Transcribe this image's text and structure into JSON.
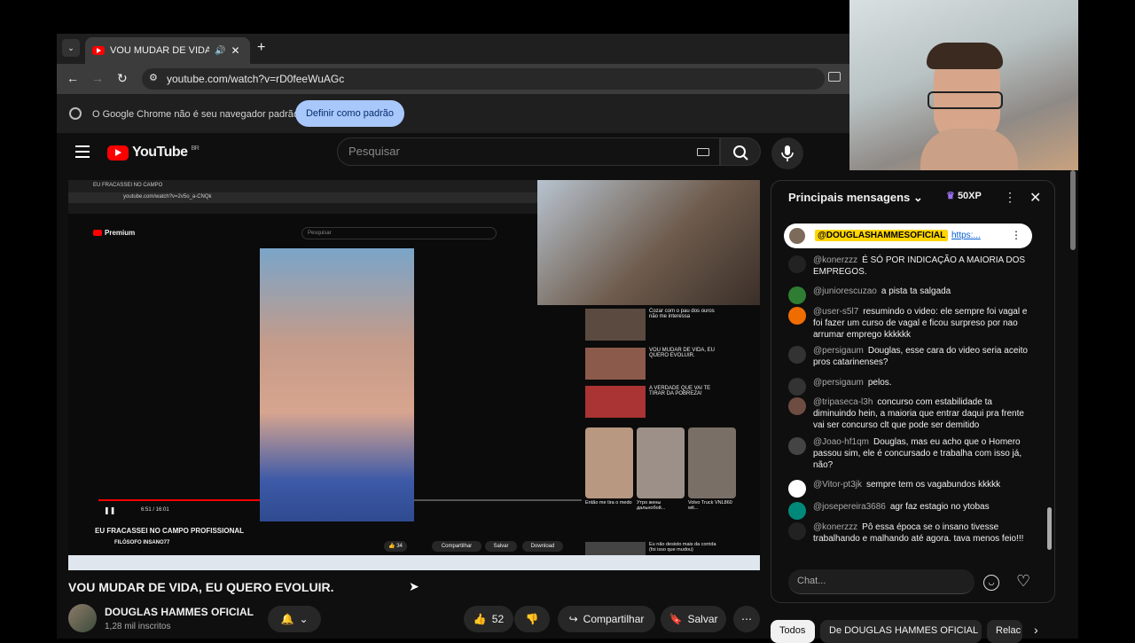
{
  "browser": {
    "tab_title": "VOU MUDAR DE VIDA, EU",
    "url": "youtube.com/watch?v=rD0feeWuAGc",
    "infobar_text": "O Google Chrome não é seu navegador padrão",
    "infobar_button": "Definir como padrão"
  },
  "youtube": {
    "logo_text": "YouTube",
    "region": "BR",
    "search_placeholder": "Pesquisar"
  },
  "video": {
    "title": "VOU MUDAR DE VIDA, EU QUERO EVOLUIR.",
    "channel": "DOUGLAS HAMMES OFICIAL",
    "subscribers": "1,28 mil inscritos",
    "likes": "52",
    "share_label": "Compartilhar",
    "save_label": "Salvar",
    "inner": {
      "title": "EU FRACASSEI NO CAMPO PROFISSIONAL",
      "channel": "FILÓSOFO INSANO77",
      "time": "6:51 / 16:01",
      "search": "Pesquisar",
      "logo": "Premium",
      "url": "youtube.com/watch?v=2v5o_a-CNQk",
      "tab": "EU FRACASSEI NO CAMPO",
      "likes": "34",
      "share": "Compartilhar",
      "save": "Salvar",
      "download": "Download",
      "rec1_title": "Cozar com o pau dos ouros não me interessa",
      "rec2_title": "VOU MUDAR DE VIDA, EU QUERO EVOLUIR.",
      "rec3_title": "A VERDADE QUE VAI TE TIRAR DA POBREZA!",
      "short1": "Então me tira o medo",
      "short2": "Утро жены дальнобой...",
      "short3": "Volvo Truck VNL860 wit...",
      "rec4_title": "Eu não desisto mais da corrida (foi isso que mudou)"
    }
  },
  "chat": {
    "header": "Principais mensagens",
    "xp": "50XP",
    "pinned_author": "@DOUGLASHAMMESOFICIAL",
    "pinned_link": "https:...",
    "input_placeholder": "Chat...",
    "messages": [
      {
        "author": "@konerzzz",
        "text": "É SÓ POR INDICAÇÃO A MAIORIA DOS EMPREGOS."
      },
      {
        "author": "@juniorescuzao",
        "text": "a pista ta salgada"
      },
      {
        "author": "@user-s5l7",
        "text": "resumindo o video: ele sempre foi vagal e foi fazer um curso de vagal e ficou surpreso por nao arrumar emprego kkkkkk"
      },
      {
        "author": "@persigaum",
        "text": "Douglas, esse cara do video seria aceito pros catarinenses?"
      },
      {
        "author": "@persigaum",
        "text": "pelos."
      },
      {
        "author": "@tripaseca-l3h",
        "text": "concurso com estabilidade ta diminuindo hein, a maioria que entrar daqui pra frente vai ser concurso clt que pode ser demitido"
      },
      {
        "author": "@Joao-hf1qm",
        "text": "Douglas, mas eu acho que o Homero passou sim, ele é concursado e trabalha com isso já, não?"
      },
      {
        "author": "@Vitor-pt3jk",
        "text": "sempre tem os vagabundos kkkkk"
      },
      {
        "author": "@josepereira3686",
        "text": "agr faz estagio no ytobas"
      },
      {
        "author": "@konerzzz",
        "text": "Pô essa época se o insano tivesse trabalhando e malhando até agora. tava menos feio!!!"
      }
    ],
    "avatar_colors": [
      "#222",
      "#2e7d32",
      "#ef6c00",
      "#333",
      "#333",
      "#6d4c41",
      "#444",
      "#fff",
      "#00897b",
      "#222"
    ]
  },
  "chips": [
    "Todos",
    "De DOUGLAS HAMMES OFICIAL",
    "Relac"
  ]
}
